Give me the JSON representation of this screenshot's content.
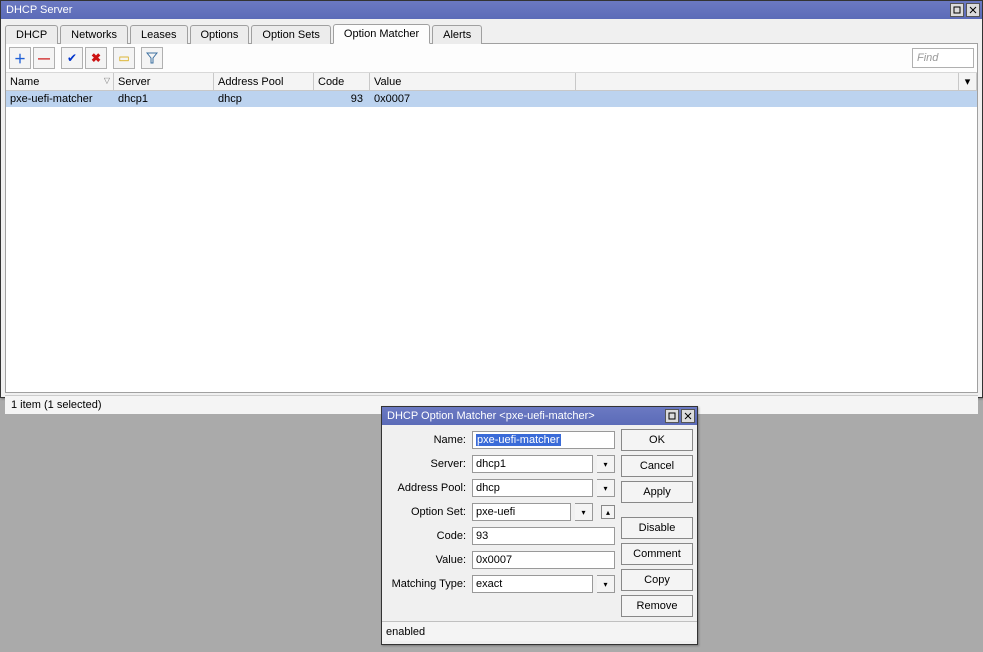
{
  "mainWindow": {
    "title": "DHCP Server",
    "tabs": [
      "DHCP",
      "Networks",
      "Leases",
      "Options",
      "Option Sets",
      "Option Matcher",
      "Alerts"
    ],
    "activeTab": "Option Matcher",
    "find_placeholder": "Find",
    "columns": {
      "name": "Name",
      "server": "Server",
      "pool": "Address Pool",
      "code": "Code",
      "value": "Value"
    },
    "row": {
      "name": "pxe-uefi-matcher",
      "server": "dhcp1",
      "pool": "dhcp",
      "code": "93",
      "value": "0x0007"
    },
    "status": "1 item (1 selected)"
  },
  "dialog": {
    "title": "DHCP Option Matcher <pxe-uefi-matcher>",
    "labels": {
      "name": "Name:",
      "server": "Server:",
      "pool": "Address Pool:",
      "optset": "Option Set:",
      "code": "Code:",
      "value": "Value:",
      "mtype": "Matching Type:"
    },
    "fields": {
      "name": "pxe-uefi-matcher",
      "server": "dhcp1",
      "pool": "dhcp",
      "optset": "pxe-uefi",
      "code": "93",
      "value": "0x0007",
      "mtype": "exact"
    },
    "buttons": {
      "ok": "OK",
      "cancel": "Cancel",
      "apply": "Apply",
      "disable": "Disable",
      "comment": "Comment",
      "copy": "Copy",
      "remove": "Remove"
    },
    "status": "enabled"
  }
}
